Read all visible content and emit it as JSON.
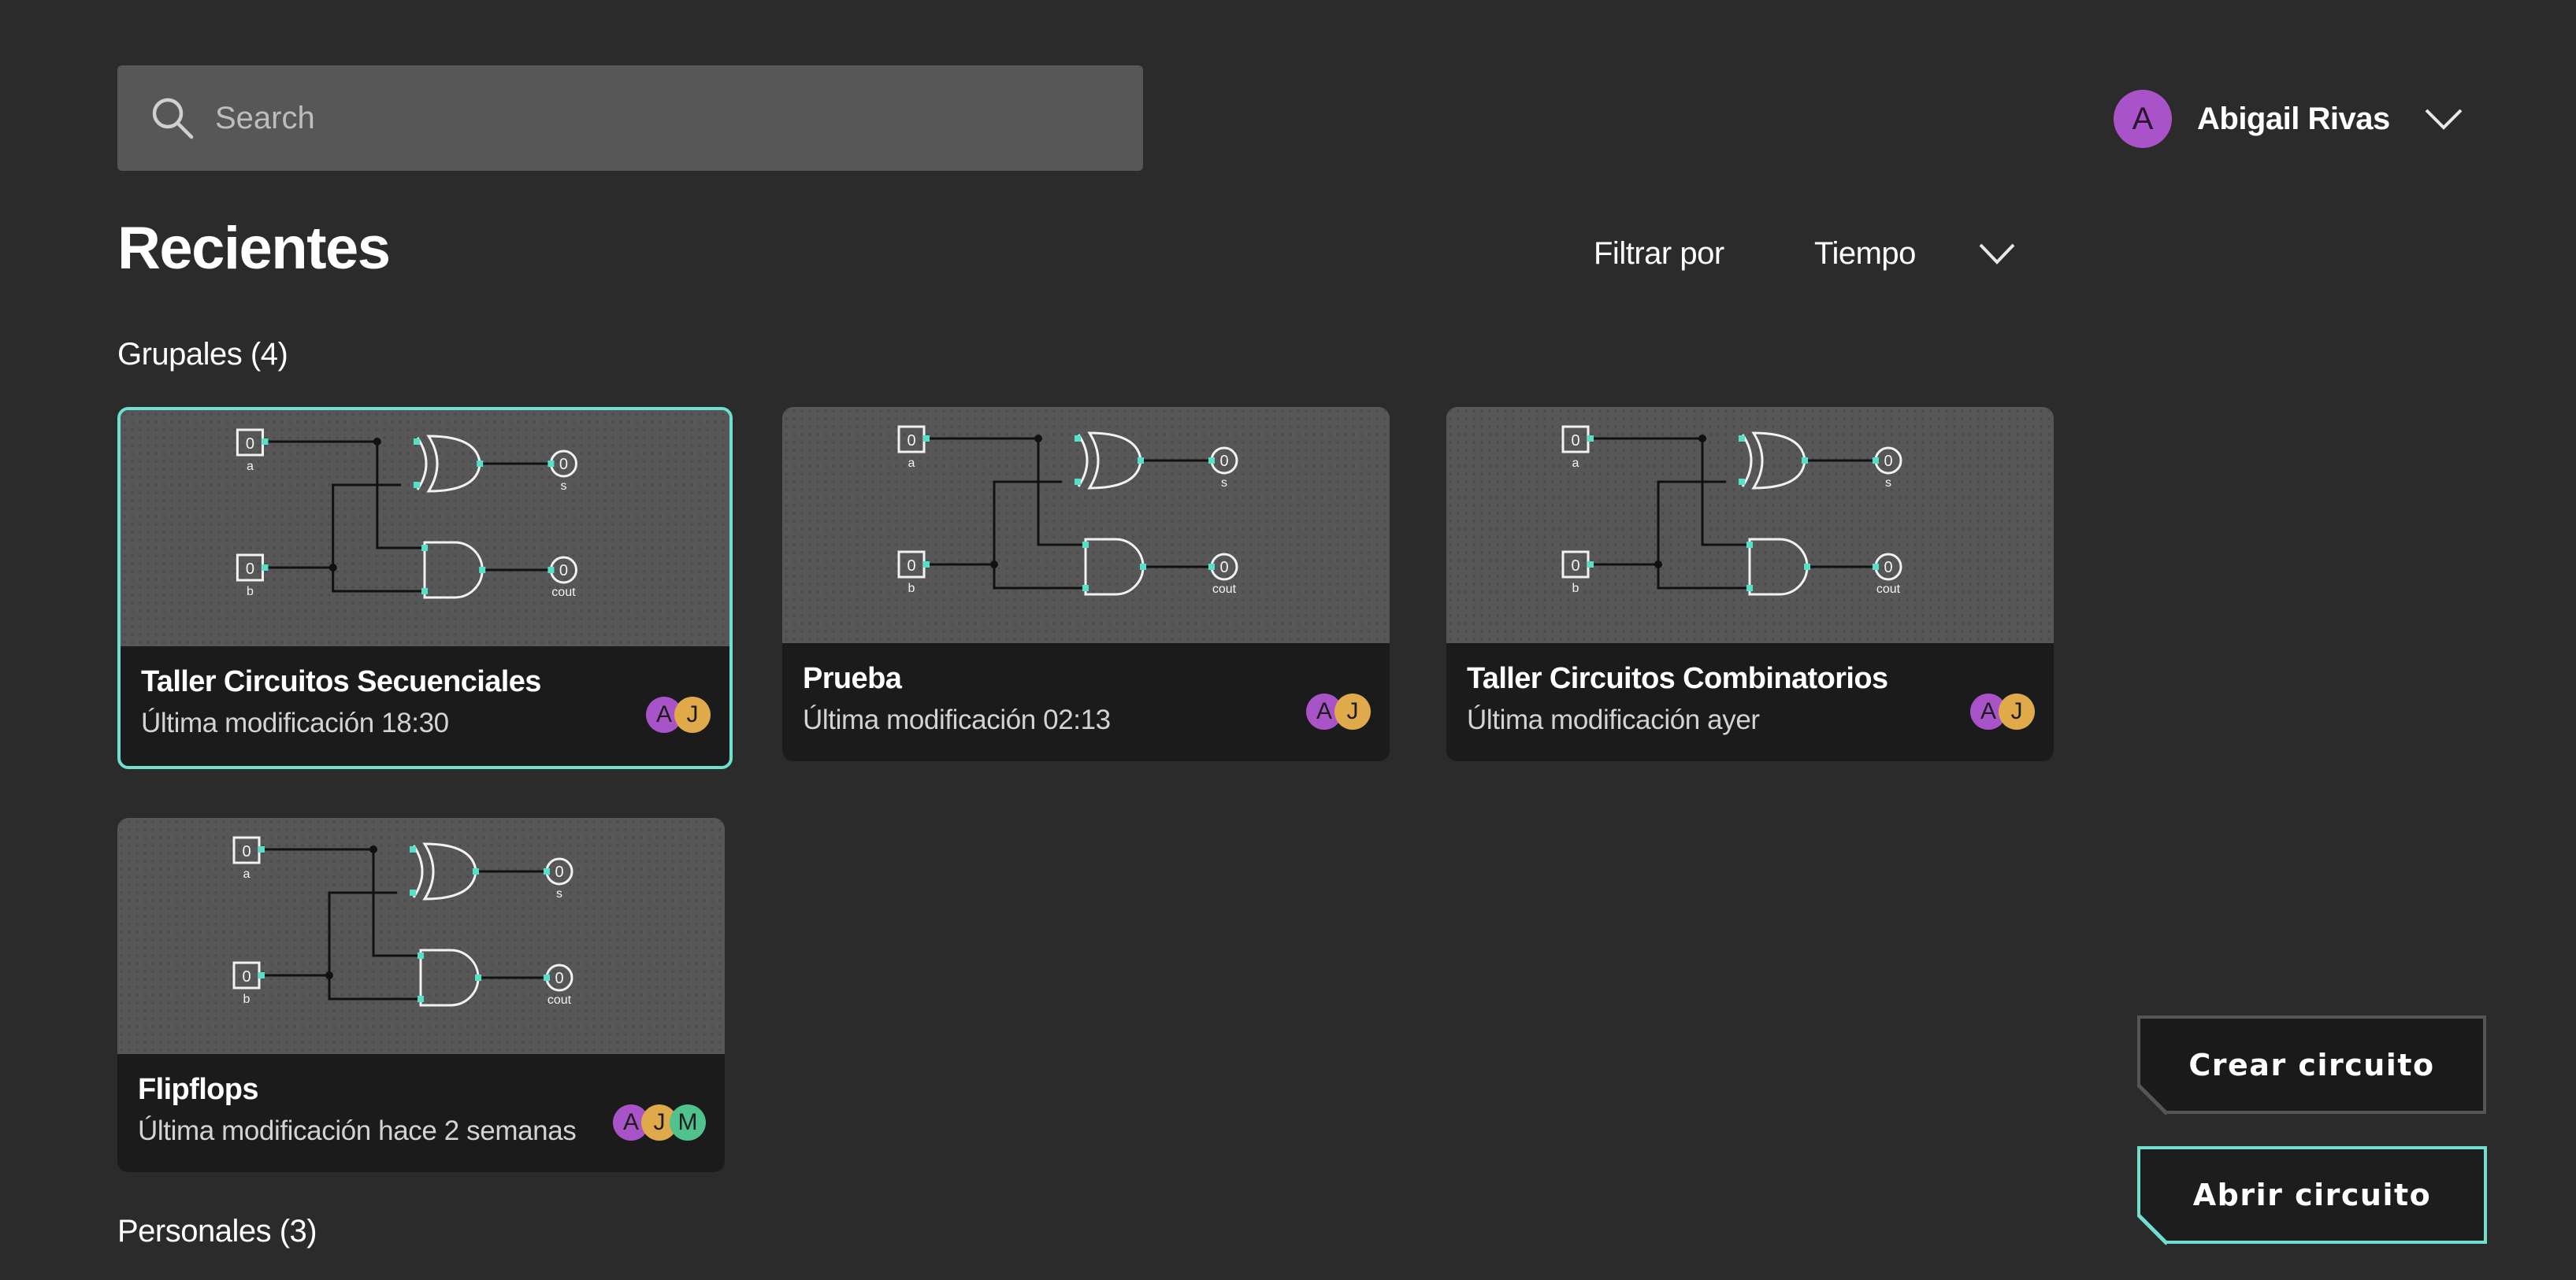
{
  "search": {
    "placeholder": "Search",
    "icon": "search-icon"
  },
  "user": {
    "initial": "A",
    "name": "Abigail Rivas",
    "avatar_color": "#a953c9"
  },
  "page_title": "Recientes",
  "filter": {
    "label": "Filtrar por",
    "value": "Tiempo"
  },
  "group_section": {
    "title": "Grupales (4)"
  },
  "personal_section": {
    "title": "Personales (3)"
  },
  "circuit_labels": {
    "input_value": "0",
    "output_value": "0",
    "input_a": "a",
    "input_b": "b",
    "output_s": "s",
    "output_cout": "cout"
  },
  "cards": [
    {
      "title": "Taller Circuitos Secuenciales",
      "modified": "Última modificación 18:30",
      "selected": true,
      "collaborators": [
        {
          "initial": "A",
          "color": "#a953c9"
        },
        {
          "initial": "J",
          "color": "#e0a94a"
        }
      ]
    },
    {
      "title": "Prueba",
      "modified": "Última modificación 02:13",
      "selected": false,
      "collaborators": [
        {
          "initial": "A",
          "color": "#a953c9"
        },
        {
          "initial": "J",
          "color": "#e0a94a"
        }
      ]
    },
    {
      "title": "Taller Circuitos Combinatorios",
      "modified": "Última modificación ayer",
      "selected": false,
      "collaborators": [
        {
          "initial": "A",
          "color": "#a953c9"
        },
        {
          "initial": "J",
          "color": "#e0a94a"
        }
      ]
    },
    {
      "title": "Flipflops",
      "modified": "Última modificación hace 2 semanas",
      "selected": false,
      "collaborators": [
        {
          "initial": "A",
          "color": "#a953c9"
        },
        {
          "initial": "J",
          "color": "#e0a94a"
        },
        {
          "initial": "M",
          "color": "#4fc28e"
        }
      ]
    }
  ],
  "buttons": {
    "create": "Crear circuito",
    "open": "Abrir circuito"
  },
  "colors": {
    "background": "#2b2b2b",
    "accent": "#6fe0cf",
    "card_info": "#1b1b1b",
    "thumbnail": "#575757"
  }
}
